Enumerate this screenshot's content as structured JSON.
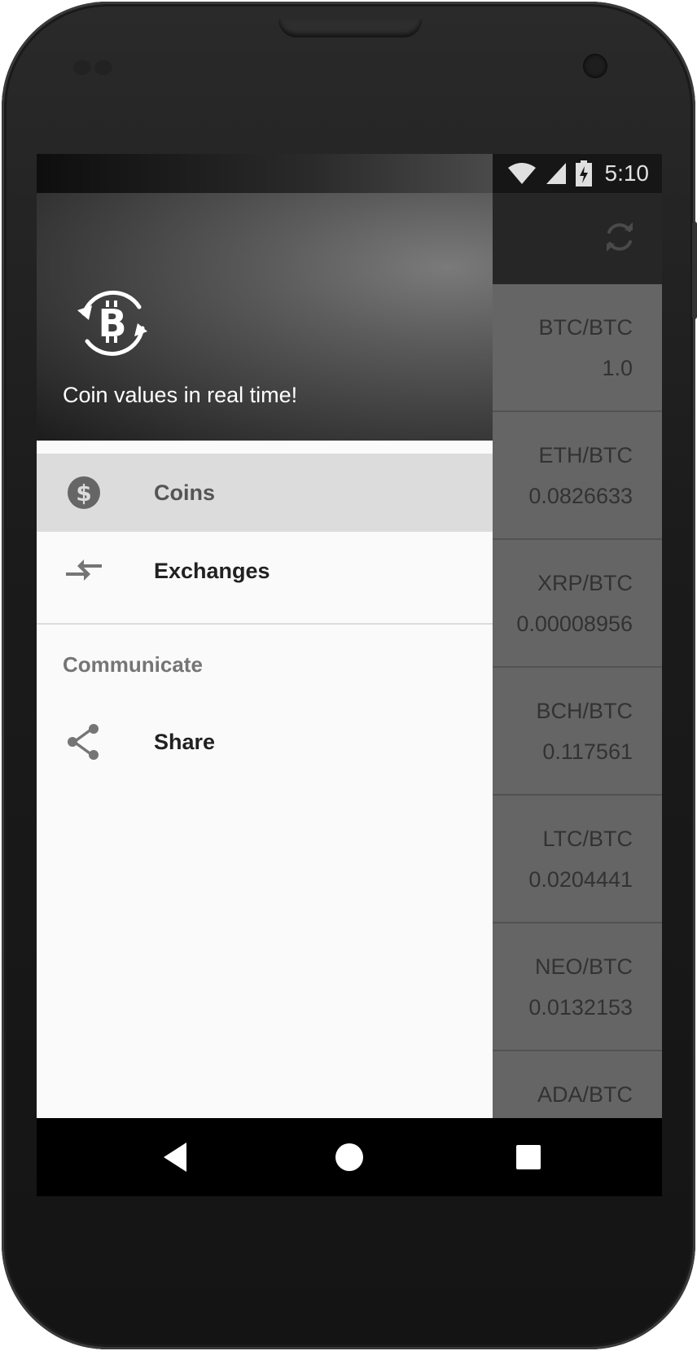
{
  "status_bar": {
    "time": "5:10",
    "icons": [
      "wifi-icon",
      "signal-icon",
      "battery-charging-icon"
    ]
  },
  "app_bar": {
    "action_icon": "refresh-icon"
  },
  "coin_list": [
    {
      "pair": "BTC/BTC",
      "value": "1.0"
    },
    {
      "pair": "ETH/BTC",
      "value": "0.0826633"
    },
    {
      "pair": "XRP/BTC",
      "value": "0.00008956"
    },
    {
      "pair": "BCH/BTC",
      "value": "0.117561"
    },
    {
      "pair": "LTC/BTC",
      "value": "0.0204441"
    },
    {
      "pair": "NEO/BTC",
      "value": "0.0132153"
    },
    {
      "pair": "ADA/BTC",
      "value": ""
    }
  ],
  "drawer": {
    "header_logo": "bitcoin-exchange-icon",
    "subtitle": "Coin values in real time!",
    "items": [
      {
        "label": "Coins",
        "icon": "dollar-circle-icon",
        "active": true
      },
      {
        "label": "Exchanges",
        "icon": "compare-arrows-icon",
        "active": false
      }
    ],
    "section": {
      "title": "Communicate",
      "items": [
        {
          "label": "Share",
          "icon": "share-icon"
        }
      ]
    }
  },
  "system_nav": {
    "icons": [
      "back-icon",
      "home-icon",
      "recents-icon"
    ]
  },
  "colors": {
    "drawer_background": "#fafafa",
    "active_item": "#dcdcdc",
    "app_bar": "#2c2c2c",
    "list_background": "#747474"
  }
}
